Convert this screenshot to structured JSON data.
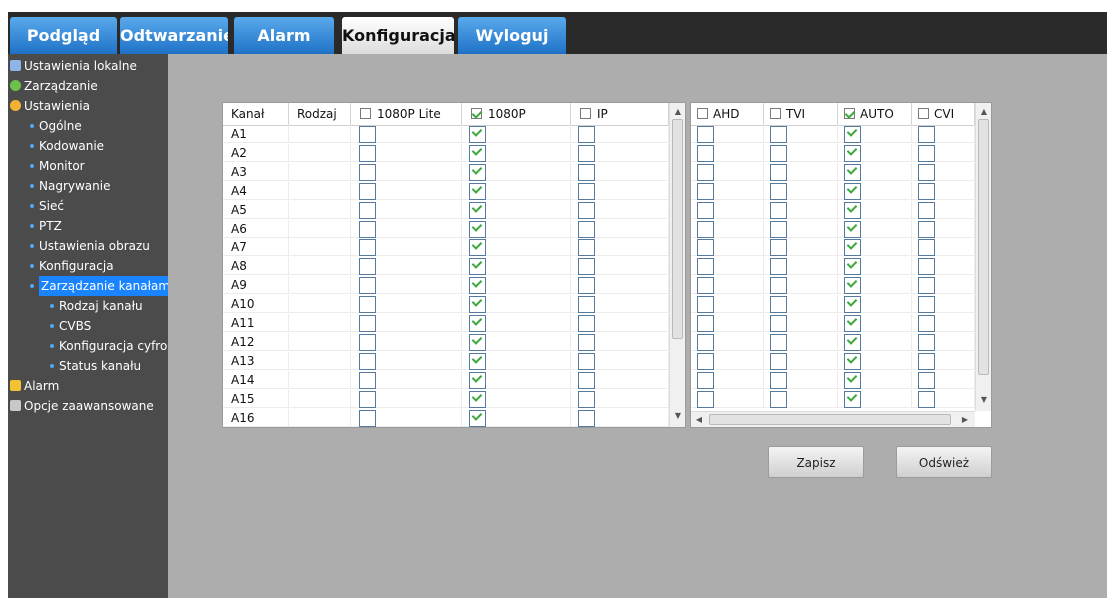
{
  "nav": {
    "tabs": [
      {
        "label": "Podgląd",
        "active": false
      },
      {
        "label": "Odtwarzanie",
        "active": false
      },
      {
        "label": "Alarm",
        "active": false
      },
      {
        "label": "Konfiguracja",
        "active": true
      },
      {
        "label": "Wyloguj",
        "active": false
      }
    ]
  },
  "sidebar": {
    "items": [
      {
        "label": "Ustawienia lokalne",
        "icon": "monitor-icon"
      },
      {
        "label": "Zarządzanie",
        "icon": "info-icon"
      },
      {
        "label": "Ustawienia",
        "icon": "gear-icon"
      },
      {
        "label": "Ogólne",
        "icon": "bullet-icon"
      },
      {
        "label": "Kodowanie",
        "icon": "bullet-icon"
      },
      {
        "label": "Monitor",
        "icon": "bullet-icon"
      },
      {
        "label": "Nagrywanie",
        "icon": "bullet-icon"
      },
      {
        "label": "Sieć",
        "icon": "bullet-icon"
      },
      {
        "label": "PTZ",
        "icon": "bullet-icon"
      },
      {
        "label": "Ustawienia obrazu",
        "icon": "bullet-icon"
      },
      {
        "label": "Konfiguracja",
        "icon": "bullet-icon"
      },
      {
        "label": "Zarządzanie kanałami",
        "icon": "bullet-icon",
        "selected": true
      },
      {
        "label": "Rodzaj kanału",
        "icon": "bullet-icon"
      },
      {
        "label": "CVBS",
        "icon": "bullet-icon"
      },
      {
        "label": "Konfiguracja cyfrowa",
        "icon": "bullet-icon"
      },
      {
        "label": "Status kanału",
        "icon": "bullet-icon"
      },
      {
        "label": "Alarm",
        "icon": "bell-icon"
      },
      {
        "label": "Opcje zaawansowane",
        "icon": "tools-icon"
      }
    ]
  },
  "left_grid": {
    "headers": [
      {
        "label": "Kanał",
        "checkbox": false
      },
      {
        "label": "Rodzaj",
        "checkbox": false
      },
      {
        "label": "1080P Lite",
        "checkbox": true,
        "checked": false
      },
      {
        "label": "1080P",
        "checkbox": true,
        "checked": true
      },
      {
        "label": "IP",
        "checkbox": true,
        "checked": false
      }
    ],
    "rows": [
      {
        "channel": "A1",
        "values": [
          false,
          true,
          false
        ]
      },
      {
        "channel": "A2",
        "values": [
          false,
          true,
          false
        ]
      },
      {
        "channel": "A3",
        "values": [
          false,
          true,
          false
        ]
      },
      {
        "channel": "A4",
        "values": [
          false,
          true,
          false
        ]
      },
      {
        "channel": "A5",
        "values": [
          false,
          true,
          false
        ]
      },
      {
        "channel": "A6",
        "values": [
          false,
          true,
          false
        ]
      },
      {
        "channel": "A7",
        "values": [
          false,
          true,
          false
        ]
      },
      {
        "channel": "A8",
        "values": [
          false,
          true,
          false
        ]
      },
      {
        "channel": "A9",
        "values": [
          false,
          true,
          false
        ]
      },
      {
        "channel": "A10",
        "values": [
          false,
          true,
          false
        ]
      },
      {
        "channel": "A11",
        "values": [
          false,
          true,
          false
        ]
      },
      {
        "channel": "A12",
        "values": [
          false,
          true,
          false
        ]
      },
      {
        "channel": "A13",
        "values": [
          false,
          true,
          false
        ]
      },
      {
        "channel": "A14",
        "values": [
          false,
          true,
          false
        ]
      },
      {
        "channel": "A15",
        "values": [
          false,
          true,
          false
        ]
      },
      {
        "channel": "A16",
        "values": [
          false,
          true,
          false
        ]
      }
    ]
  },
  "right_grid": {
    "headers": [
      {
        "label": "AHD",
        "checked": false
      },
      {
        "label": "TVI",
        "checked": false
      },
      {
        "label": "AUTO",
        "checked": true
      },
      {
        "label": "CVI",
        "checked": false
      }
    ],
    "rows": [
      [
        false,
        false,
        true,
        false
      ],
      [
        false,
        false,
        true,
        false
      ],
      [
        false,
        false,
        true,
        false
      ],
      [
        false,
        false,
        true,
        false
      ],
      [
        false,
        false,
        true,
        false
      ],
      [
        false,
        false,
        true,
        false
      ],
      [
        false,
        false,
        true,
        false
      ],
      [
        false,
        false,
        true,
        false
      ],
      [
        false,
        false,
        true,
        false
      ],
      [
        false,
        false,
        true,
        false
      ],
      [
        false,
        false,
        true,
        false
      ],
      [
        false,
        false,
        true,
        false
      ],
      [
        false,
        false,
        true,
        false
      ],
      [
        false,
        false,
        true,
        false
      ],
      [
        false,
        false,
        true,
        false
      ]
    ]
  },
  "buttons": {
    "save": "Zapisz",
    "refresh": "Odśwież"
  }
}
